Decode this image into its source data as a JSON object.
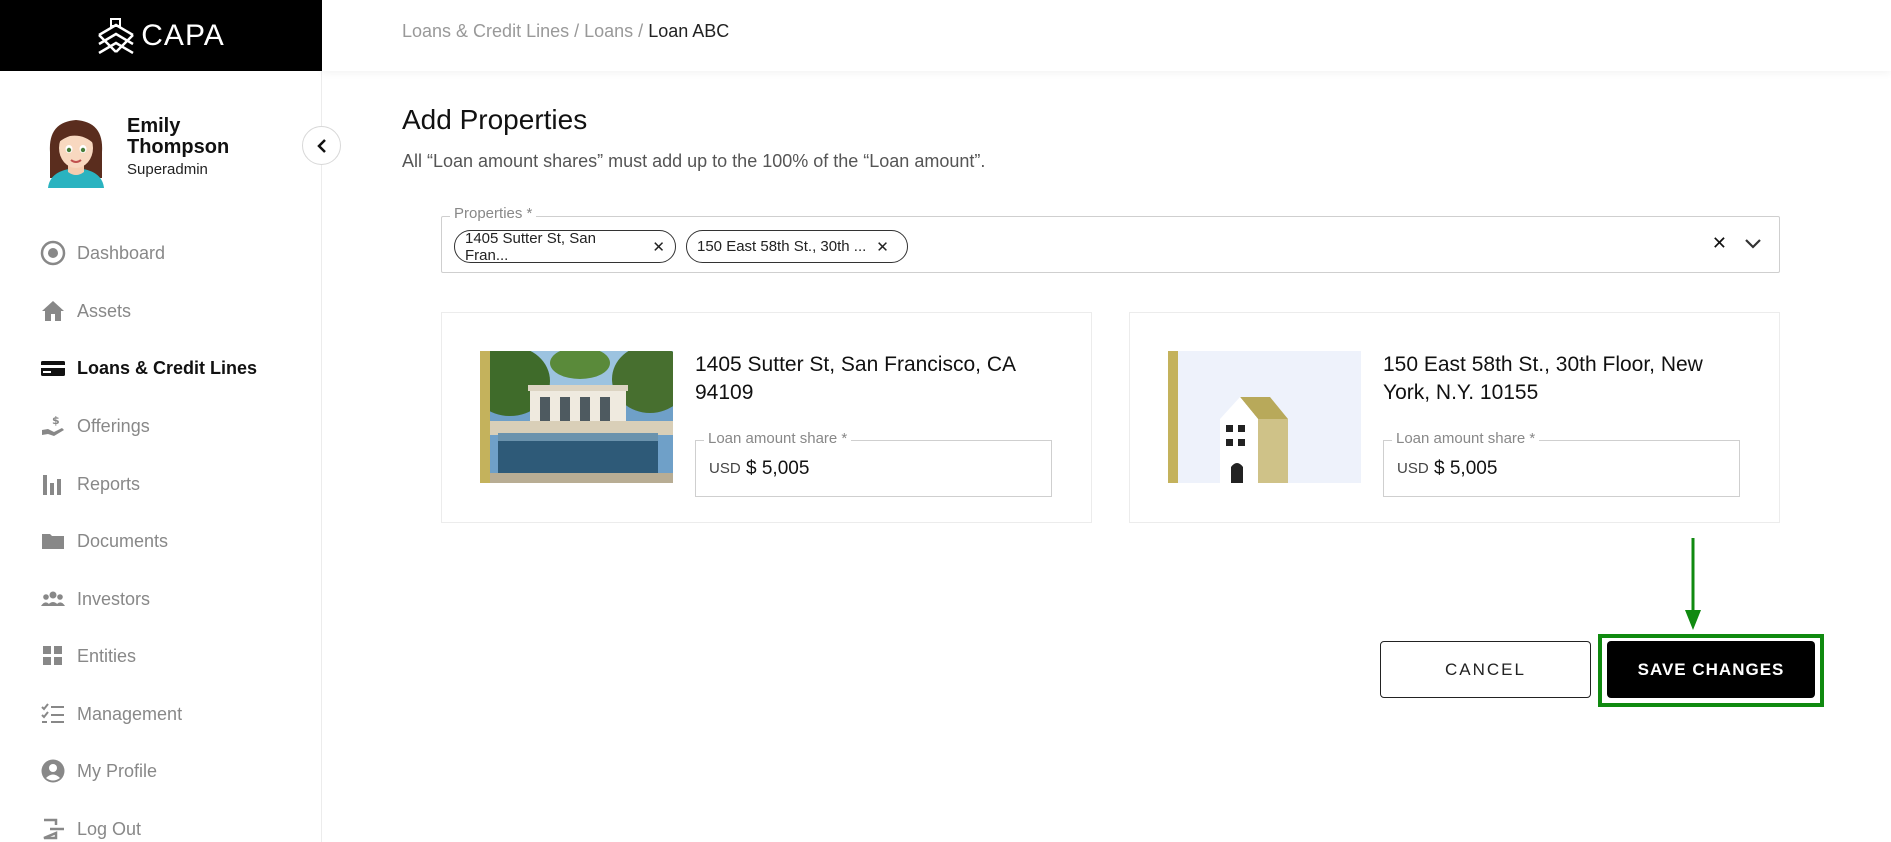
{
  "brand": {
    "name": "CAPA"
  },
  "user": {
    "name": "Emily Thompson",
    "role": "Superadmin"
  },
  "nav": [
    {
      "label": "Dashboard",
      "icon": "dashboard-icon",
      "active": false
    },
    {
      "label": "Assets",
      "icon": "home-icon",
      "active": false
    },
    {
      "label": "Loans & Credit Lines",
      "icon": "credit-card-icon",
      "active": true
    },
    {
      "label": "Offerings",
      "icon": "hand-dollar-icon",
      "active": false
    },
    {
      "label": "Reports",
      "icon": "bar-chart-icon",
      "active": false
    },
    {
      "label": "Documents",
      "icon": "folder-icon",
      "active": false
    },
    {
      "label": "Investors",
      "icon": "people-icon",
      "active": false
    },
    {
      "label": "Entities",
      "icon": "grid-icon",
      "active": false
    },
    {
      "label": "Management",
      "icon": "checklist-icon",
      "active": false
    },
    {
      "label": "My Profile",
      "icon": "user-circle-icon",
      "active": false
    },
    {
      "label": "Log Out",
      "icon": "logout-icon",
      "active": false
    }
  ],
  "breadcrumb": {
    "part1": "Loans & Credit Lines /",
    "part2": "Loans /",
    "current": "Loan ABC"
  },
  "page": {
    "title": "Add Properties",
    "subtitle": "All “Loan amount shares” must add up to the 100% of the “Loan amount”."
  },
  "properties_field": {
    "label": "Properties *",
    "chips": [
      "1405 Sutter St, San Fran...",
      "150 East 58th St., 30th ..."
    ]
  },
  "cards": [
    {
      "address": "1405 Sutter St, San Francisco, CA 94109",
      "amount_label": "Loan amount share *",
      "currency": "USD",
      "amount": "$ 5,005"
    },
    {
      "address": "150 East 58th St., 30th Floor, New York, N.Y. 10155",
      "amount_label": "Loan amount share *",
      "currency": "USD",
      "amount": "$ 5,005"
    }
  ],
  "actions": {
    "cancel": "CANCEL",
    "save": "SAVE CHANGES"
  },
  "colors": {
    "accent": "#c4b25c",
    "highlight": "#108a10"
  }
}
